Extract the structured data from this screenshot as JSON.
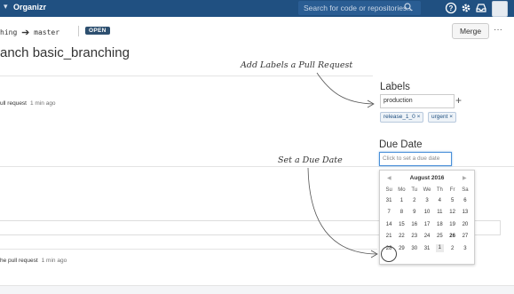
{
  "topbar": {
    "brand": "Organizr",
    "search_placeholder": "Search for code or repositories..."
  },
  "pr": {
    "source_branch": "hing",
    "target_branch": "master",
    "arrow": "➔",
    "status": "OPEN",
    "title": "anch basic_branching",
    "merge_label": "Merge",
    "more_label": "···"
  },
  "activity": [
    {
      "text": "ull request",
      "ago": "1 min ago"
    },
    {
      "text": "he pull request",
      "ago": "1 min ago"
    }
  ],
  "annotations": {
    "labels_note": "Add Labels a Pull Request",
    "due_note": "Set a Due Date"
  },
  "labels": {
    "heading": "Labels",
    "input_value": "production",
    "add_label": "+",
    "tags": [
      "release_1_0 ×",
      "urgent ×"
    ]
  },
  "due_date": {
    "heading": "Due Date",
    "placeholder": "Click to set a due date",
    "calendar": {
      "month": "August 2016",
      "prev": "◀",
      "next": "▶",
      "weekdays": [
        "Su",
        "Mo",
        "Tu",
        "We",
        "Th",
        "Fr",
        "Sa"
      ],
      "weeks": [
        [
          "31",
          "1",
          "2",
          "3",
          "4",
          "5",
          "6"
        ],
        [
          "7",
          "8",
          "9",
          "10",
          "11",
          "12",
          "13"
        ],
        [
          "14",
          "15",
          "16",
          "17",
          "18",
          "19",
          "20"
        ],
        [
          "21",
          "22",
          "23",
          "24",
          "25",
          "26",
          "27"
        ],
        [
          "28",
          "29",
          "30",
          "31",
          "1",
          "2",
          "3"
        ]
      ],
      "today": "26",
      "selected": "28"
    }
  },
  "colors": {
    "topbar": "#205081",
    "status_badge": "#2d4f6f",
    "focus": "#4a90d9"
  }
}
